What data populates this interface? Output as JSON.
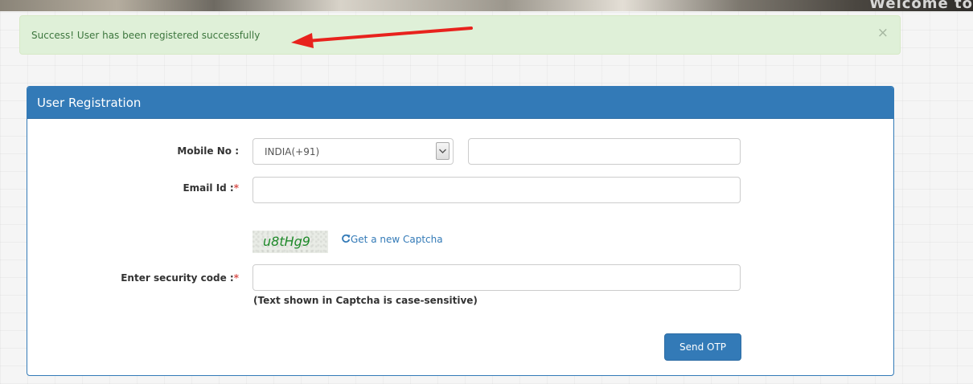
{
  "banner": {
    "text": "Welcome to"
  },
  "alert": {
    "message": "Success! User has been registered successfully",
    "close_symbol": "×",
    "color": "#3c763d",
    "background": "#dff0d8"
  },
  "annotation": {
    "arrow_color": "#e8221d",
    "arrow_icon": "arrow-left-icon"
  },
  "panel": {
    "title": "User Registration",
    "accent": "#337ab7"
  },
  "form": {
    "mobile": {
      "label": "Mobile No :",
      "country_selected": "INDIA(+91)",
      "number_value": "",
      "number_placeholder": ""
    },
    "email": {
      "label": "Email Id :",
      "required_mark": "*",
      "value": "",
      "placeholder": ""
    },
    "captcha": {
      "image_text": "u8tHg9",
      "refresh_label": "Get a new Captcha",
      "refresh_icon": "refresh-icon"
    },
    "security_code": {
      "label": "Enter security code :",
      "required_mark": "*",
      "value": "",
      "placeholder": "",
      "help": "(Text shown in Captcha is case-sensitive)"
    },
    "submit_label": "Send OTP"
  }
}
